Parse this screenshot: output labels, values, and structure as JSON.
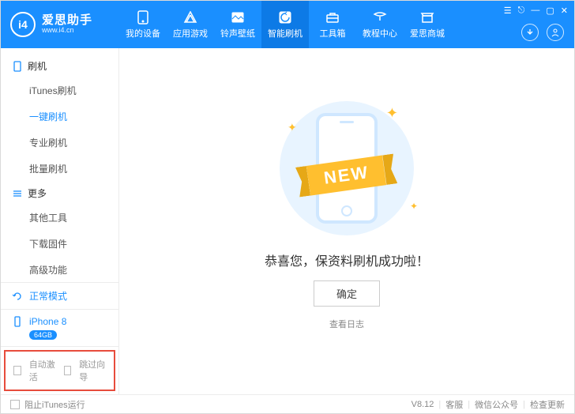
{
  "logo": {
    "badge": "i4",
    "brand": "爱思助手",
    "url": "www.i4.cn"
  },
  "nav": [
    {
      "label": "我的设备"
    },
    {
      "label": "应用游戏"
    },
    {
      "label": "铃声壁纸"
    },
    {
      "label": "智能刷机"
    },
    {
      "label": "工具箱"
    },
    {
      "label": "教程中心"
    },
    {
      "label": "爱思商城"
    }
  ],
  "sidebar": {
    "group1": {
      "title": "刷机",
      "items": [
        "iTunes刷机",
        "一键刷机",
        "专业刷机",
        "批量刷机"
      ],
      "active": 1
    },
    "group2": {
      "title": "更多",
      "items": [
        "其他工具",
        "下载固件",
        "高级功能"
      ]
    },
    "mode": "正常模式",
    "device": {
      "name": "iPhone 8",
      "storage": "64GB"
    },
    "opts": [
      "自动激活",
      "跳过向导"
    ]
  },
  "main": {
    "ribbon": "NEW",
    "success": "恭喜您，保资料刷机成功啦！",
    "confirm": "确定",
    "log": "查看日志"
  },
  "status": {
    "block_itunes": "阻止iTunes运行",
    "version": "V8.12",
    "links": [
      "客服",
      "微信公众号",
      "检查更新"
    ]
  }
}
